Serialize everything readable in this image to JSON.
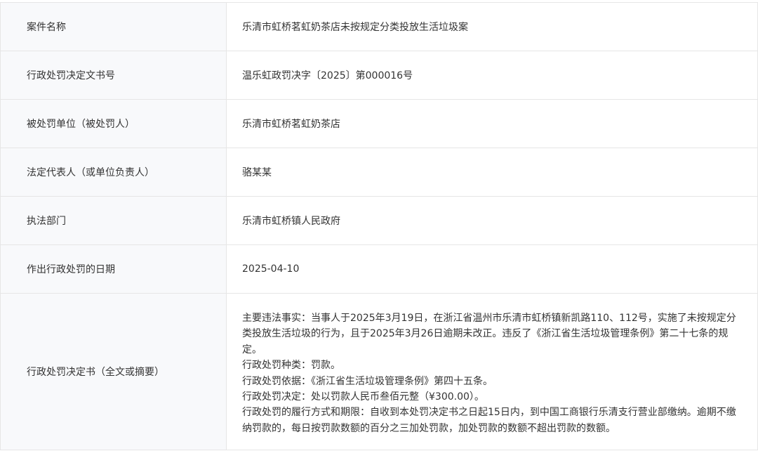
{
  "rows": [
    {
      "label": "案件名称",
      "value": "乐清市虹桥茗虹奶茶店未按规定分类投放生活垃圾案"
    },
    {
      "label": "行政处罚决定文书号",
      "value": "温乐虹政罚决字〔2025〕第000016号"
    },
    {
      "label": "被处罚单位（被处罚人）",
      "value": "乐清市虹桥茗虹奶茶店"
    },
    {
      "label": "法定代表人（或单位负责人）",
      "value": "骆某某"
    },
    {
      "label": "执法部门",
      "value": "乐清市虹桥镇人民政府"
    },
    {
      "label": "作出行政处罚的日期",
      "value": "2025-04-10"
    }
  ],
  "decision": {
    "label": "行政处罚决定书（全文或摘要）",
    "lines": [
      "主要违法事实：当事人于2025年3月19日，在浙江省温州市乐清市虹桥镇新凯路110、112号，实施了未按规定分类投放生活垃圾的行为，且于2025年3月26日逾期未改正。违反了《浙江省生活垃圾管理条例》第二十七条的规定。",
      "行政处罚种类：罚款。",
      "行政处罚依据：《浙江省生活垃圾管理条例》第四十五条。",
      "行政处罚决定：处以罚款人民币叁佰元整（¥300.00）。",
      "行政处罚的履行方式和期限：自收到本处罚决定书之日起15日内，到中国工商银行乐清支行营业部缴纳。逾期不缴纳罚款的，每日按罚款数额的百分之三加处罚款，加处罚款的数额不超出罚款的数额。"
    ]
  }
}
